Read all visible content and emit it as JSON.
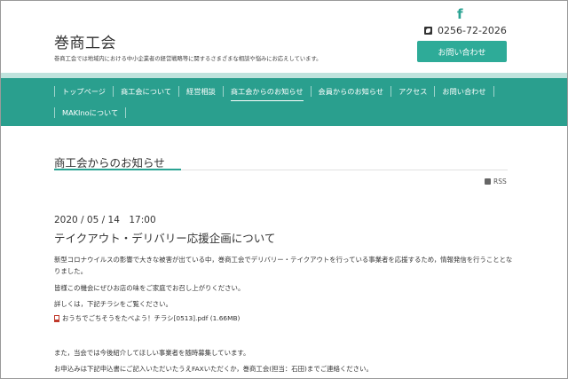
{
  "header": {
    "site_title": "巻商工会",
    "site_description": "巻商工会では地域内における中小企業者の経営戦略等に関するさまざまな相談や悩みにお応えしています。",
    "facebook_icon": "facebook-icon",
    "phone_icon": "phone-icon",
    "phone": "0256-72-2026",
    "contact_button": "お問い合わせ"
  },
  "nav": {
    "row1": [
      "トップページ",
      "商工会について",
      "経営相談",
      "商工会からのお知らせ",
      "会員からのお知らせ",
      "アクセス",
      "お問い合わせ"
    ],
    "row2": [
      "MAKInoについて"
    ],
    "active": "商工会からのお知らせ"
  },
  "main": {
    "page_title": "商工会からのお知らせ",
    "rss_label": "RSS",
    "post": {
      "date": "2020 / 05 / 14　17:00",
      "title": "テイクアウト・デリバリー応援企画について",
      "paragraph1": "新型コロナウイルスの影響で大きな被害が出ている中，巻商工会でデリバリー・テイクアウトを行っている事業者を応援するため，情報発信を行うこととなりました。",
      "paragraph2": "皆様この機会にぜひお店の味をご家庭でお召し上がりください。",
      "paragraph3": "詳しくは，下記チラシをご覧ください。",
      "pdf_link": "おうちでごちそうをたべよう！チラシ[0513].pdf (1.66MB)",
      "paragraph4": "また，当会では今後紹介してほしい事業者を随時募集しています。",
      "paragraph5": "お申込みは下記申込書にご記入いただいたうえFAXいただくか，巻商工会(担当：石田)までご連絡ください。"
    }
  },
  "colors": {
    "accent": "#2aa393",
    "nav_background": "#2a9f8e",
    "nav_band": "#bfe3dd"
  }
}
